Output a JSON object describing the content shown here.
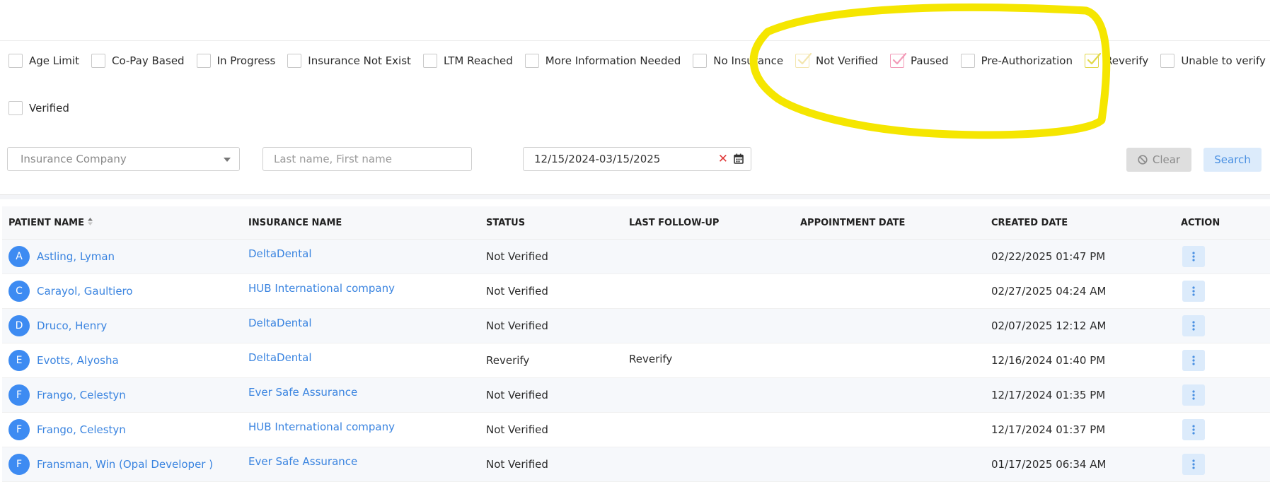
{
  "filters": [
    {
      "label": "Age Limit",
      "checked": false,
      "check_color": ""
    },
    {
      "label": "Co-Pay Based",
      "checked": false,
      "check_color": ""
    },
    {
      "label": "In Progress",
      "checked": false,
      "check_color": ""
    },
    {
      "label": "Insurance Not Exist",
      "checked": false,
      "check_color": ""
    },
    {
      "label": "LTM Reached",
      "checked": false,
      "check_color": ""
    },
    {
      "label": "More Information Needed",
      "checked": false,
      "check_color": ""
    },
    {
      "label": "No Insurance",
      "checked": false,
      "check_color": ""
    },
    {
      "label": "Not Verified",
      "checked": true,
      "check_color": "#f3e6b0"
    },
    {
      "label": "Paused",
      "checked": true,
      "check_color": "#f29bb8"
    },
    {
      "label": "Pre-Authorization",
      "checked": false,
      "check_color": ""
    },
    {
      "label": "Reverify",
      "checked": true,
      "check_color": "#e2d84a"
    },
    {
      "label": "Unable to verify",
      "checked": false,
      "check_color": ""
    },
    {
      "label": "Verified",
      "checked": false,
      "check_color": ""
    }
  ],
  "controls": {
    "insurance_placeholder": "Insurance Company",
    "name_placeholder": "Last name, First name",
    "date_range": "12/15/2024-03/15/2025",
    "clear_label": "Clear",
    "search_label": "Search"
  },
  "table": {
    "headers": {
      "patient": "PATIENT NAME",
      "insurance": "INSURANCE NAME",
      "status": "STATUS",
      "followup": "LAST FOLLOW-UP",
      "appointment": "APPOINTMENT DATE",
      "created": "CREATED DATE",
      "action": "ACTION"
    },
    "rows": [
      {
        "initial": "A",
        "name": "Astling, Lyman",
        "insurance": "DeltaDental",
        "status": "Not Verified",
        "followup": "",
        "appointment": "",
        "created": "02/22/2025 01:47 PM"
      },
      {
        "initial": "C",
        "name": "Carayol, Gaultiero",
        "insurance": "HUB International company",
        "status": "Not Verified",
        "followup": "",
        "appointment": "",
        "created": "02/27/2025 04:24 AM"
      },
      {
        "initial": "D",
        "name": "Druco, Henry",
        "insurance": "DeltaDental",
        "status": "Not Verified",
        "followup": "",
        "appointment": "",
        "created": "02/07/2025 12:12 AM"
      },
      {
        "initial": "E",
        "name": "Evotts, Alyosha",
        "insurance": "DeltaDental",
        "status": "Reverify",
        "followup": "Reverify",
        "appointment": "",
        "created": "12/16/2024 01:40 PM"
      },
      {
        "initial": "F",
        "name": "Frango, Celestyn",
        "insurance": "Ever Safe Assurance",
        "status": "Not Verified",
        "followup": "",
        "appointment": "",
        "created": "12/17/2024 01:35 PM"
      },
      {
        "initial": "F",
        "name": "Frango, Celestyn",
        "insurance": "HUB International company",
        "status": "Not Verified",
        "followup": "",
        "appointment": "",
        "created": "12/17/2024 01:37 PM"
      },
      {
        "initial": "F",
        "name": "Fransman, Win (Opal Developer )",
        "insurance": "Ever Safe Assurance",
        "status": "Not Verified",
        "followup": "",
        "appointment": "",
        "created": "01/17/2025 06:34 AM"
      }
    ]
  },
  "annotation_color": "#f5e600"
}
